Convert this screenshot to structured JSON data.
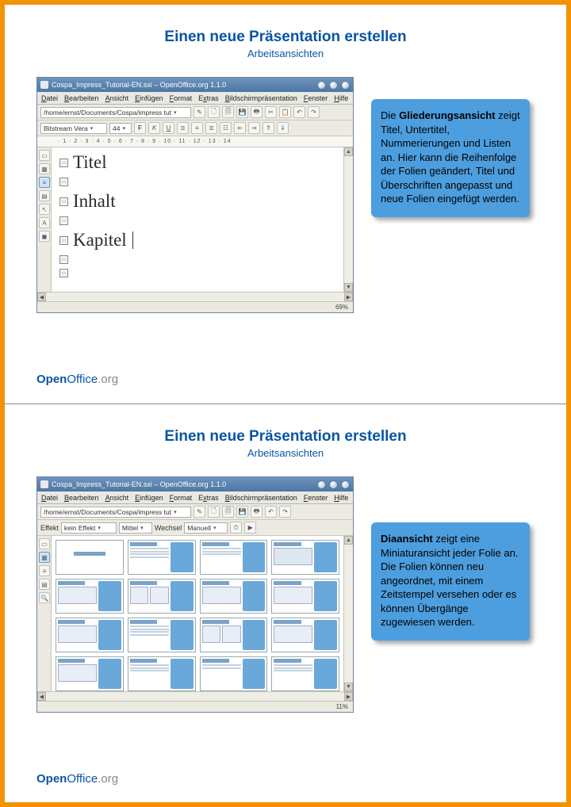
{
  "page1": {
    "title": "Einen neue Präsentation erstellen",
    "subtitle": "Arbeitsansichten",
    "win_title": "Cospa_Impress_Tutorial-EN.sxi – OpenOffice.org 1.1.0",
    "path": "/home/ernst/Documents/Cospa/impress tut",
    "font_name": "Bitstream Vera",
    "font_size": "44",
    "ruler": "· 1 · 2 · 3 · 4 · 5 · 6 · 7 · 8 · 9 · 10 · 11 · 12 · 13 · 14",
    "outline": [
      "Titel",
      "Inhalt",
      "Kapitel"
    ],
    "zoom": "69%",
    "menus": [
      "Datei",
      "Bearbeiten",
      "Ansicht",
      "Einfügen",
      "Format",
      "Extras",
      "Bildschirmpräsentation",
      "Fenster",
      "Hilfe"
    ],
    "callout_bold": "Gliederungsansicht",
    "callout_rest": " zeigt Titel, Untertitel, Nummerierungen und Listen an. Hier kann die Reihenfolge der Folien geändert, Titel und Überschriften angepasst und neue Folien eingefügt werden.",
    "footer1": "Open",
    "footer2": "Office",
    "footer3": ".org"
  },
  "page2": {
    "title": "Einen neue Präsentation erstellen",
    "subtitle": "Arbeitsansichten",
    "win_title": "Cospa_Impress_Tutorial-EN.sxi – OpenOffice.org 1.1.0",
    "path": "/home/ernst/Documents/Cospa/impress tut",
    "effect_label": "Effekt",
    "effect_value": "kein Effekt",
    "speed_value": "Mittel",
    "change_label": "Wechsel",
    "change_value": "Manuell",
    "zoom": "11%",
    "menus": [
      "Datei",
      "Bearbeiten",
      "Ansicht",
      "Einfügen",
      "Format",
      "Extras",
      "Bildschirmpräsentation",
      "Fenster",
      "Hilfe"
    ],
    "callout_bold": "Diaansicht",
    "callout_rest": " zeigt eine Miniaturansicht jeder Folie an. Die Folien können neu angeordnet, mit einem Zeitstempel versehen oder es können Übergänge zugewiesen werden.",
    "footer1": "Open",
    "footer2": "Office",
    "footer3": ".org"
  }
}
